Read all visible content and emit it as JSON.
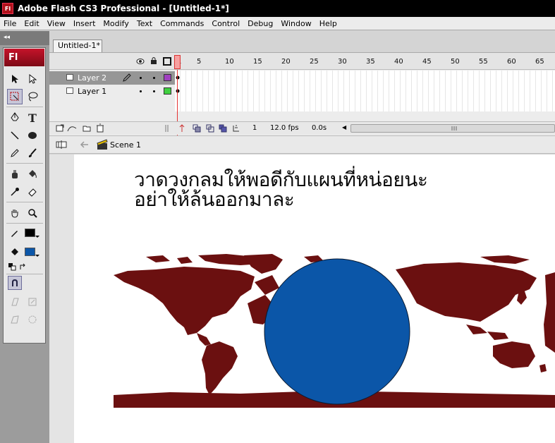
{
  "window": {
    "title": "Adobe Flash CS3 Professional - [Untitled-1*]",
    "icon_text": "Fl"
  },
  "menu": [
    "File",
    "Edit",
    "View",
    "Insert",
    "Modify",
    "Text",
    "Commands",
    "Control",
    "Debug",
    "Window",
    "Help"
  ],
  "tools": {
    "logo_text": "Fl",
    "collapse_glyph": "◂◂"
  },
  "document": {
    "tab_label": "Untitled-1*"
  },
  "timeline": {
    "frame_numbers": [
      "1",
      "5",
      "10",
      "15",
      "20",
      "25",
      "30",
      "35",
      "40",
      "45",
      "50",
      "55",
      "60",
      "65"
    ],
    "layers": [
      {
        "name": "Layer 2",
        "selected": true,
        "color": "#a040c0"
      },
      {
        "name": "Layer 1",
        "selected": false,
        "color": "#40d040"
      }
    ],
    "current_frame": "1",
    "fps": "12.0 fps",
    "elapsed": "0.0s"
  },
  "editbar": {
    "scene": "Scene 1"
  },
  "stage": {
    "text_line1": "วาดวงกลมให้พอดีกับแผนที่หน่อยนะ",
    "text_line2": "อย่าให้ล้นออกมาละ",
    "circle_color": "#0b56a8",
    "map_color": "#6b1010"
  },
  "colors": {
    "stroke": "#000000",
    "fill": "#0b56a8"
  }
}
